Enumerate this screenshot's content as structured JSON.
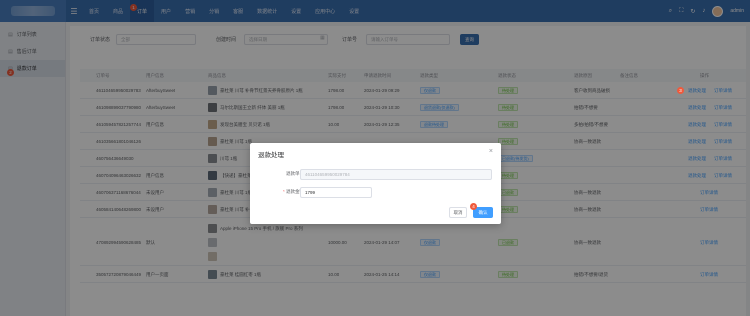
{
  "header": {
    "nav": [
      "首页",
      "商品",
      "订单",
      "用户",
      "营销",
      "分销",
      "客服",
      "数据统计",
      "设置",
      "应用中心",
      "设置"
    ],
    "active_nav": 2,
    "user": "admin"
  },
  "sidebar": {
    "items": [
      {
        "label": "订单列表",
        "icon": "list-icon"
      },
      {
        "label": "售后订单",
        "icon": "return-icon"
      },
      {
        "label": "退款订单",
        "icon": "refund-icon"
      }
    ],
    "active": 2
  },
  "filters": {
    "status_label": "订单状态",
    "status_placeholder": "全部",
    "date_label": "创建时间",
    "date_placeholder": "选择日期",
    "order_label": "订单号",
    "order_placeholder": "请输入订单号",
    "search_btn": "查询"
  },
  "table": {
    "columns": [
      "订单号",
      "用户信息",
      "商品信息",
      "实际支付",
      "申请退款时间",
      "退款类型",
      "退款状态",
      "退款原因",
      "备注信息",
      "操作"
    ],
    "rows": [
      {
        "id": "461104659950029783",
        "user": "AfterbuySweet",
        "product": "豪杜莱 川芎 补骨节红景天养骨胶原片 1瓶",
        "pay": "1798.00",
        "time": "2024-01-29 09:29",
        "type": "仅退款",
        "status": "待处理",
        "reason": "客户收到商品破损",
        "remark": "",
        "ops": [
          "退款处理",
          "订单详情"
        ]
      },
      {
        "id": "461098899037790980",
        "user": "AfterbuySweet",
        "product": "马尔比斯国王立新 纤体 美丽 1瓶",
        "pay": "1798.00",
        "time": "2024-01-29 10:30",
        "type": "退货退款(仅退款)",
        "status": "待处理",
        "reason": "拍错/不想要",
        "remark": "",
        "ops": [
          "退款处理",
          "订单详情"
        ]
      },
      {
        "id": "461059457821257744",
        "user": "用户信息",
        "product": "发现台美膳宝 贝贝诺 1瓶",
        "pay": "10.00",
        "time": "2024-01-29 12:35",
        "type": "退款待处理",
        "status": "待处理",
        "reason": "多拍/拍错/不想要",
        "remark": "",
        "ops": [
          "退款处理",
          "订单详情"
        ]
      },
      {
        "id": "461035661801046126",
        "user": "",
        "product": "豪杜莱 川芎 1瓶",
        "pay": "",
        "time": "",
        "type": "",
        "status": "待处理",
        "reason": "协商一致退款",
        "remark": "",
        "ops": [
          "退款处理",
          "订单详情"
        ]
      },
      {
        "id": "460756436649030",
        "user": "",
        "product": "川芎 1瓶",
        "pay": "",
        "time": "",
        "type": "",
        "status": "已退款(待发货)",
        "reason": "",
        "remark": "",
        "ops": [
          "退款处理",
          "订单详情"
        ]
      },
      {
        "id": "460704096463026632",
        "user": "用户信息",
        "product": "【快递】豪杜莱 1瓶",
        "pay": "",
        "time": "",
        "type": "",
        "status": "待处理",
        "reason": "",
        "remark": "",
        "ops": [
          "退款处理",
          "订单详情"
        ]
      },
      {
        "id": "460706371168676044",
        "user": "未设用户",
        "product": "豪杜莱 川芎 1瓶",
        "pay": "",
        "time": "",
        "type": "",
        "status": "已退款",
        "reason": "协商一致退款",
        "remark": "",
        "ops": [
          "订单详情"
        ]
      },
      {
        "id": "460584140648269800",
        "user": "未设用户",
        "product": "豪杜莱 川芎 补骨节红景天养骨胶原片 1瓶",
        "pay": "1798.00",
        "time": "2024-01-27 14:18",
        "type": "仅退款",
        "status": "待处理",
        "reason": "协商一致退款",
        "remark": "",
        "ops": [
          "订单详情"
        ]
      },
      {
        "id": "470892994590628485",
        "user": "默认",
        "product": "Apple iPhone 15 Pro 手机 / 旗舰 Pro 系列",
        "pay": "10000.00",
        "time": "2024-01-29 14:07",
        "type": "仅退款",
        "status": "已退款",
        "reason": "协商一致退款",
        "remark": "",
        "ops": [
          "订单详情"
        ]
      },
      {
        "id": "350572720879046449",
        "user": "用户一页面",
        "product": "豪杜莱 桂圆红枣 1瓶",
        "pay": "10.00",
        "time": "2024-01-25 14:14",
        "type": "仅退款",
        "status": "待处理",
        "reason": "拍错/不想要/退货",
        "remark": "",
        "ops": [
          "订单详情"
        ]
      }
    ]
  },
  "dialog": {
    "title": "退款处理",
    "order_label": "退款单号",
    "order_value": "461104659950029784",
    "amount_label": "退款金额",
    "amount_value": "1799",
    "cancel": "取消",
    "confirm": "确认"
  },
  "steps": [
    "1",
    "2",
    "3",
    "4"
  ],
  "colors": {
    "header": "#3a6fb0",
    "primary": "#409eff",
    "badge": "#f05a3c"
  }
}
